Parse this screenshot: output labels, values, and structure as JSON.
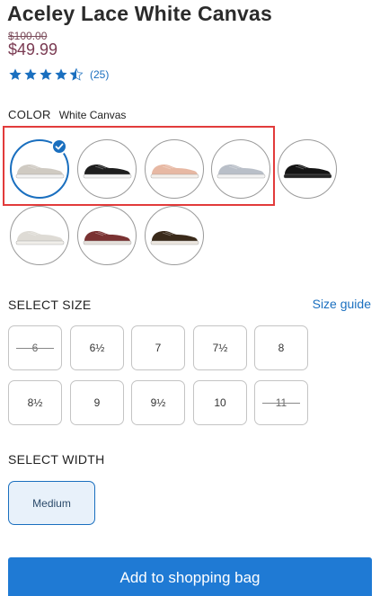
{
  "product": {
    "title": "Aceley Lace White Canvas",
    "old_price": "$100.00",
    "price": "$49.99",
    "rating": 4.5,
    "review_count": "(25)"
  },
  "color": {
    "label": "COLOR",
    "selected_value": "White Canvas",
    "swatches": [
      {
        "name": "white-canvas",
        "upper": "#cfcac2",
        "sole": "#f2f2f2",
        "selected": true
      },
      {
        "name": "black-white",
        "upper": "#1e1e1e",
        "sole": "#f2f2f2",
        "selected": false
      },
      {
        "name": "blush",
        "upper": "#e7b8a3",
        "sole": "#f4efea",
        "selected": false
      },
      {
        "name": "light-grey",
        "upper": "#b9bfc8",
        "sole": "#f2f2f2",
        "selected": false
      },
      {
        "name": "all-black",
        "upper": "#141414",
        "sole": "#232323",
        "selected": false
      },
      {
        "name": "cream",
        "upper": "#dedbd5",
        "sole": "#f0eeea",
        "selected": false
      },
      {
        "name": "burgundy",
        "upper": "#7a3232",
        "sole": "#e6e1dc",
        "selected": false
      },
      {
        "name": "leopard",
        "upper": "#3a2a1a",
        "sole": "#ece7e0",
        "selected": false
      }
    ]
  },
  "size": {
    "label": "SELECT SIZE",
    "guide_label": "Size guide",
    "options": [
      {
        "label": "6",
        "available": false
      },
      {
        "label": "6½",
        "available": true
      },
      {
        "label": "7",
        "available": true
      },
      {
        "label": "7½",
        "available": true
      },
      {
        "label": "8",
        "available": true
      },
      {
        "label": "8½",
        "available": true
      },
      {
        "label": "9",
        "available": true
      },
      {
        "label": "9½",
        "available": true
      },
      {
        "label": "10",
        "available": true
      },
      {
        "label": "11",
        "available": false
      }
    ]
  },
  "width": {
    "label": "SELECT WIDTH",
    "selected": "Medium"
  },
  "cta": {
    "label": "Add to shopping bag"
  },
  "colors": {
    "accent": "#1a6fbf",
    "button": "#1f7ad4",
    "price": "#7a3a52",
    "highlight": "#e23b3b"
  }
}
